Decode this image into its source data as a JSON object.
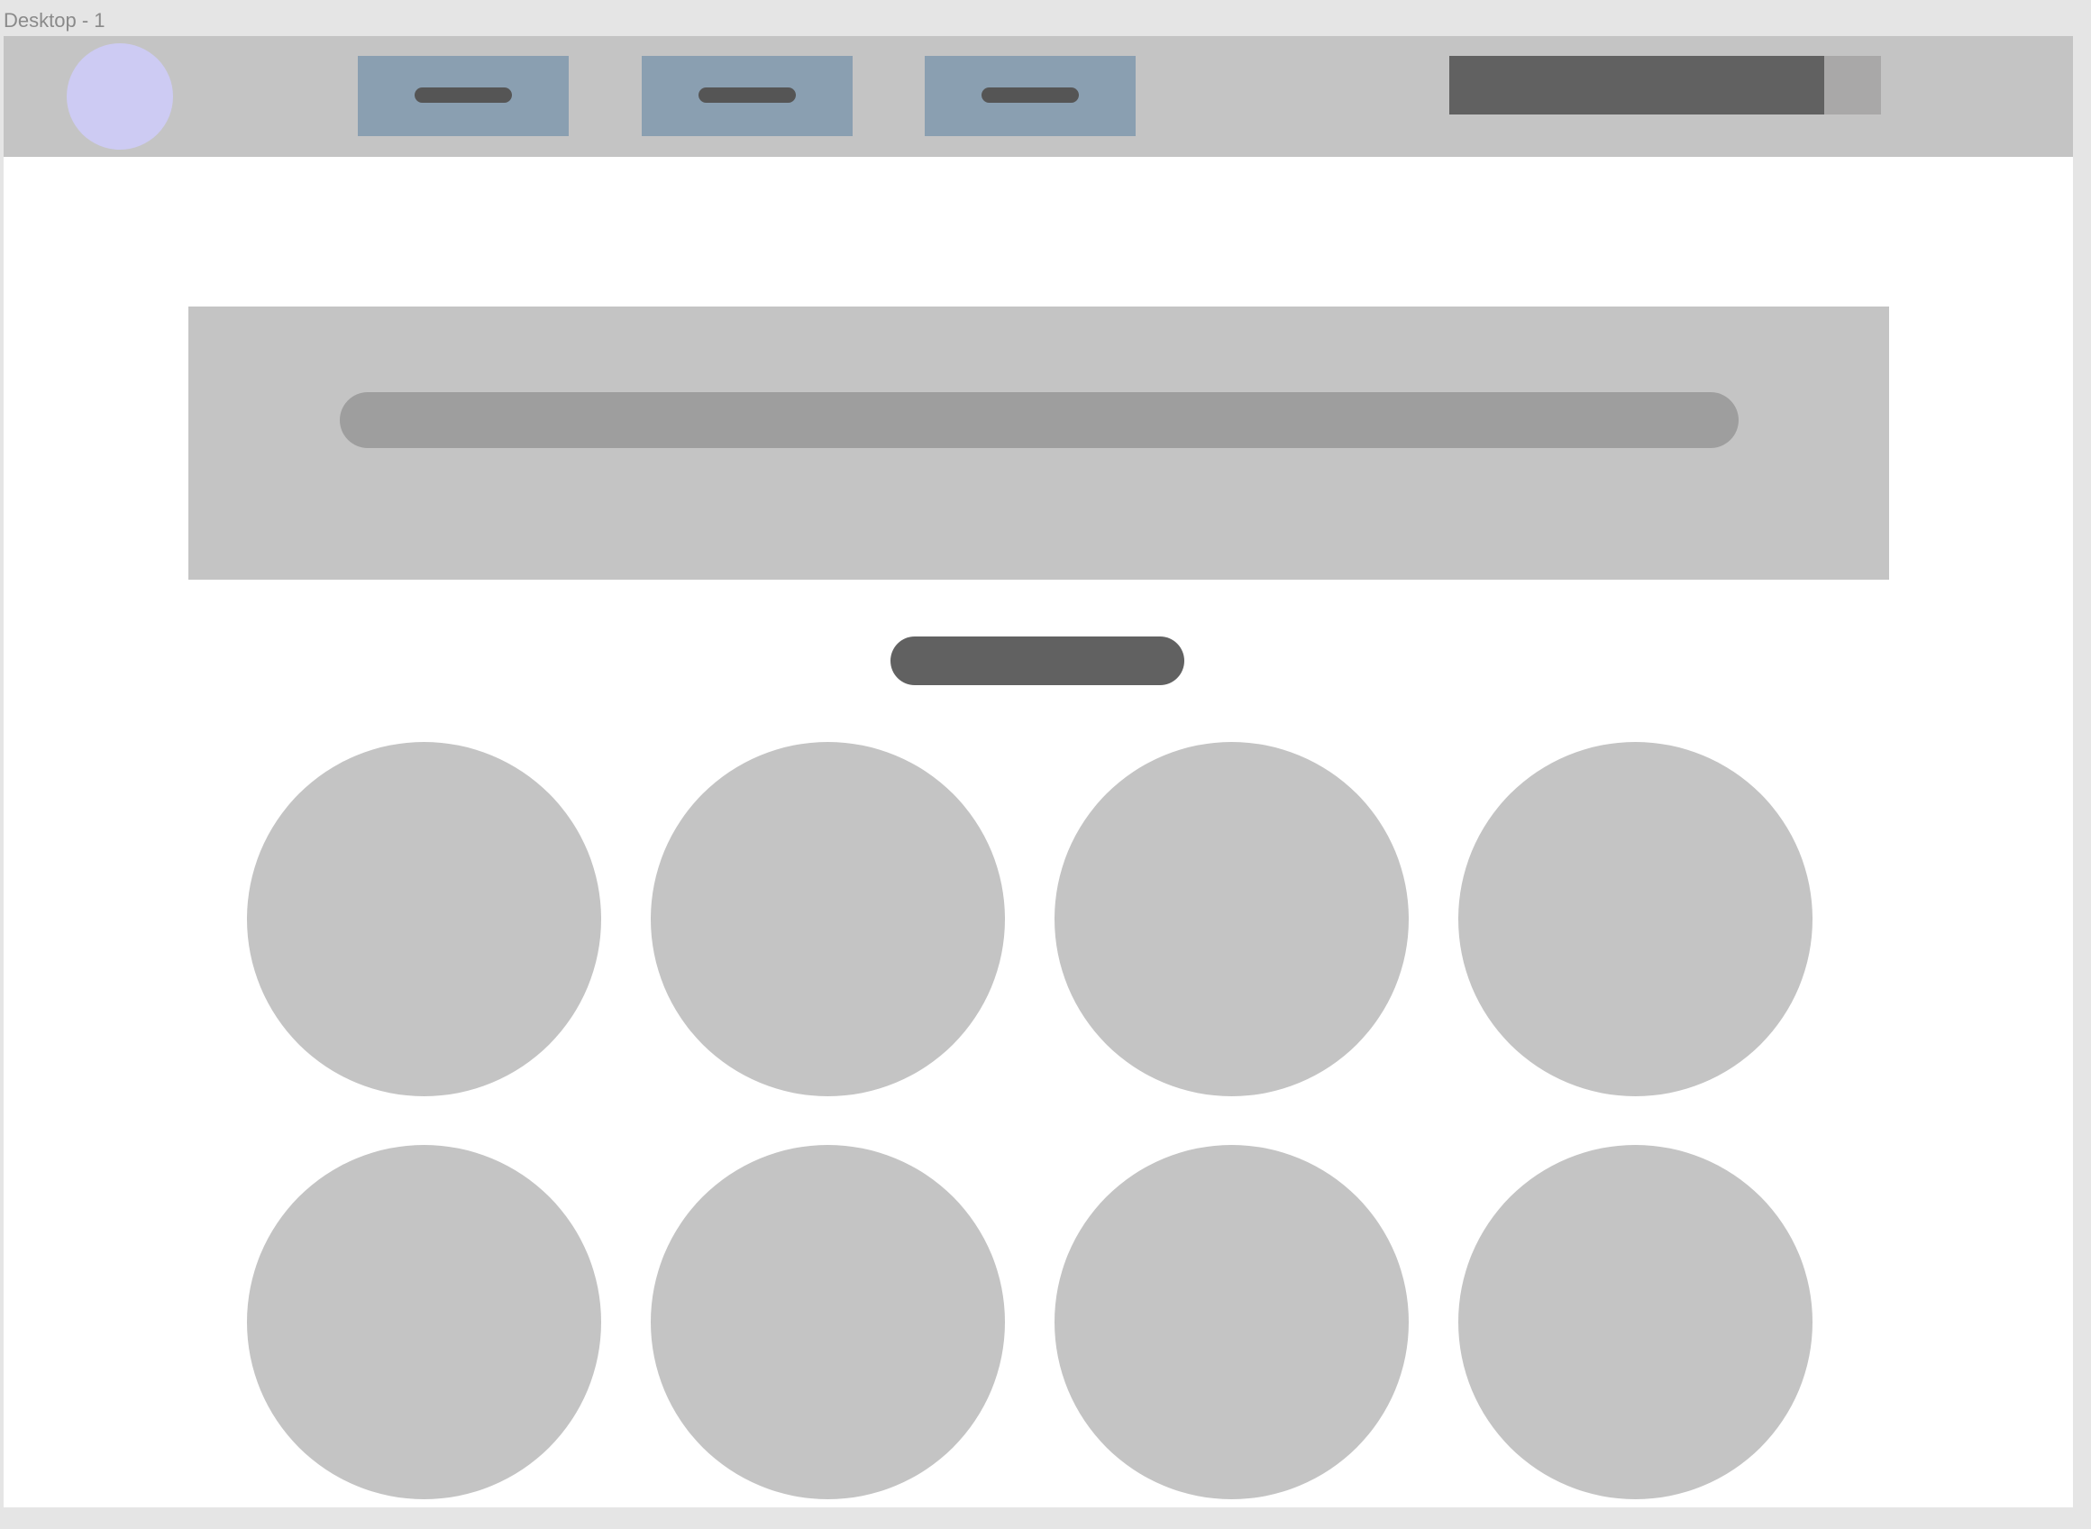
{
  "frame": {
    "title": "Desktop - 1"
  },
  "colors": {
    "canvas_background": "#e5e5e5",
    "frame_background": "#ffffff",
    "header_background": "#c4c4c4",
    "logo_color": "#cdcbf3",
    "nav_item_color": "#8a9fb1",
    "placeholder_dark": "#616161",
    "placeholder_mid": "#9e9e9e",
    "placeholder_light": "#c4c4c4",
    "search_button_color": "#a9a8a8"
  },
  "header": {
    "logo": {
      "icon": "logo-placeholder-circle"
    },
    "nav_items": [
      {
        "id": "nav-1"
      },
      {
        "id": "nav-2"
      },
      {
        "id": "nav-3"
      }
    ],
    "search": {
      "field": "search-field-placeholder",
      "button": "search-button-placeholder"
    }
  },
  "hero": {
    "banner": "hero-banner-placeholder",
    "headline_bar": "headline-text-placeholder"
  },
  "cta": {
    "button": "cta-pill-placeholder"
  },
  "grid": {
    "rows": 2,
    "columns": 4,
    "items": [
      {
        "id": "grid-item-1"
      },
      {
        "id": "grid-item-2"
      },
      {
        "id": "grid-item-3"
      },
      {
        "id": "grid-item-4"
      },
      {
        "id": "grid-item-5"
      },
      {
        "id": "grid-item-6"
      },
      {
        "id": "grid-item-7"
      },
      {
        "id": "grid-item-8"
      }
    ]
  }
}
